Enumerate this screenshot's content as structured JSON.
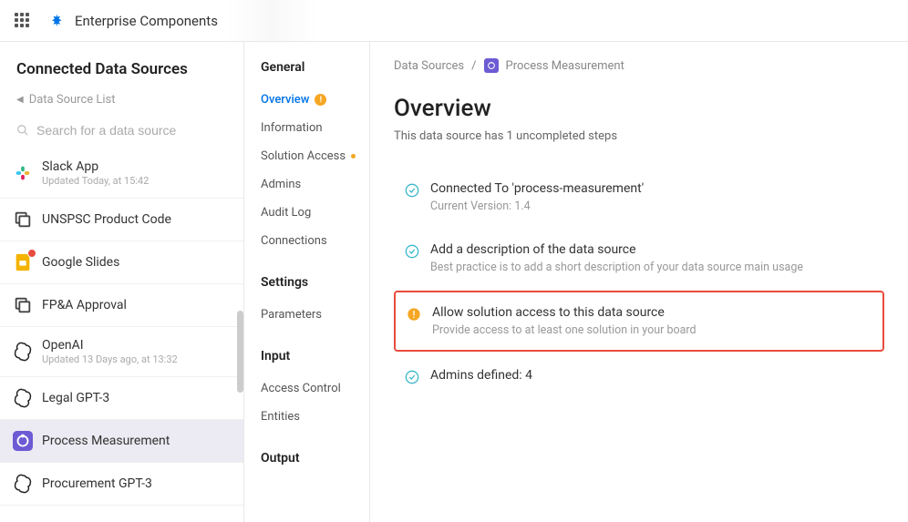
{
  "header": {
    "brand": "Enterprise Components"
  },
  "left": {
    "title": "Connected Data Sources",
    "back": "Data Source List",
    "search_placeholder": "Search for a data source",
    "items": [
      {
        "name": "Slack App",
        "meta": "Updated Today, at 15:42",
        "icon": "slack",
        "badge": false
      },
      {
        "name": "UNSPSC Product Code",
        "meta": "",
        "icon": "copy",
        "badge": false
      },
      {
        "name": "Google Slides",
        "meta": "",
        "icon": "gslides",
        "badge": true
      },
      {
        "name": "FP&A Approval",
        "meta": "",
        "icon": "copy",
        "badge": false
      },
      {
        "name": "OpenAI",
        "meta": "Updated 13 Days ago, at 13:32",
        "icon": "openai",
        "badge": false
      },
      {
        "name": "Legal GPT-3",
        "meta": "",
        "icon": "openai",
        "badge": false
      },
      {
        "name": "Process Measurement",
        "meta": "",
        "icon": "process",
        "badge": false
      },
      {
        "name": "Procurement GPT-3",
        "meta": "",
        "icon": "openai",
        "badge": false
      }
    ]
  },
  "mid": {
    "sections": [
      {
        "heading": "General",
        "items": [
          {
            "label": "Overview",
            "active": true,
            "warn": true
          },
          {
            "label": "Information"
          },
          {
            "label": "Solution Access",
            "dot": true
          },
          {
            "label": "Admins"
          },
          {
            "label": "Audit Log"
          },
          {
            "label": "Connections"
          }
        ]
      },
      {
        "heading": "Settings",
        "items": [
          {
            "label": "Parameters"
          }
        ]
      },
      {
        "heading": "Input",
        "items": [
          {
            "label": "Access Control"
          },
          {
            "label": "Entities"
          }
        ]
      },
      {
        "heading": "Output",
        "items": []
      }
    ]
  },
  "main": {
    "breadcrumb": {
      "root": "Data Sources",
      "current": "Process Measurement"
    },
    "title": "Overview",
    "subtitle": "This data source has 1 uncompleted steps",
    "steps": [
      {
        "status": "done",
        "title": "Connected To 'process-measurement'",
        "desc": "Current Version: 1.4"
      },
      {
        "status": "done",
        "title": "Add a description of the data source",
        "desc": "Best practice is to add a short description of your data source main usage"
      },
      {
        "status": "warn",
        "title": "Allow solution access to this data source",
        "desc": "Provide access to at least one solution in your board",
        "highlight": true
      },
      {
        "status": "done",
        "title": "Admins defined: 4",
        "desc": ""
      }
    ]
  }
}
